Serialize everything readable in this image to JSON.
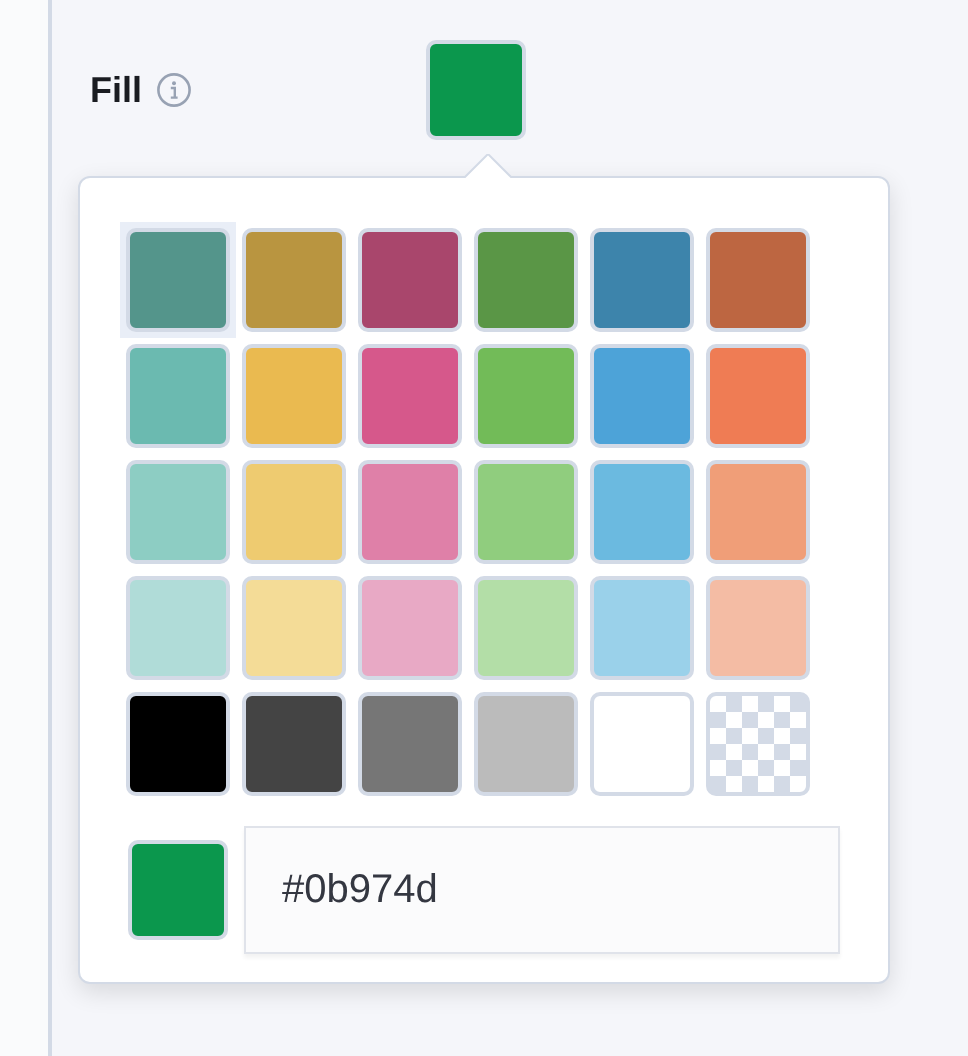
{
  "field": {
    "label": "Fill",
    "value": "#0b974d"
  },
  "swatches": [
    {
      "kind": "color",
      "color": "#54958b",
      "selected": true
    },
    {
      "kind": "color",
      "color": "#b99540",
      "selected": false
    },
    {
      "kind": "color",
      "color": "#a9466c",
      "selected": false
    },
    {
      "kind": "color",
      "color": "#5a9646",
      "selected": false
    },
    {
      "kind": "color",
      "color": "#3d84ab",
      "selected": false
    },
    {
      "kind": "color",
      "color": "#bd6641",
      "selected": false
    },
    {
      "kind": "color",
      "color": "#6bbab0",
      "selected": false
    },
    {
      "kind": "color",
      "color": "#eaba50",
      "selected": false
    },
    {
      "kind": "color",
      "color": "#d6588b",
      "selected": false
    },
    {
      "kind": "color",
      "color": "#72bb58",
      "selected": false
    },
    {
      "kind": "color",
      "color": "#4da3d8",
      "selected": false
    },
    {
      "kind": "color",
      "color": "#ef7c54",
      "selected": false
    },
    {
      "kind": "color",
      "color": "#8dcdc3",
      "selected": false
    },
    {
      "kind": "color",
      "color": "#eecb70",
      "selected": false
    },
    {
      "kind": "color",
      "color": "#df80a8",
      "selected": false
    },
    {
      "kind": "color",
      "color": "#90cd7e",
      "selected": false
    },
    {
      "kind": "color",
      "color": "#6bbae0",
      "selected": false
    },
    {
      "kind": "color",
      "color": "#f09e78",
      "selected": false
    },
    {
      "kind": "color",
      "color": "#b0dcd8",
      "selected": false
    },
    {
      "kind": "color",
      "color": "#f4dc97",
      "selected": false
    },
    {
      "kind": "color",
      "color": "#e8a9c5",
      "selected": false
    },
    {
      "kind": "color",
      "color": "#b3dea7",
      "selected": false
    },
    {
      "kind": "color",
      "color": "#9ad1ea",
      "selected": false
    },
    {
      "kind": "color",
      "color": "#f4bca4",
      "selected": false
    },
    {
      "kind": "color",
      "color": "#000000",
      "selected": false
    },
    {
      "kind": "color",
      "color": "#444444",
      "selected": false
    },
    {
      "kind": "color",
      "color": "#767676",
      "selected": false
    },
    {
      "kind": "color",
      "color": "#bbbbbb",
      "selected": false
    },
    {
      "kind": "color",
      "color": "#ffffff",
      "selected": false
    },
    {
      "kind": "transparent",
      "selected": false
    }
  ]
}
